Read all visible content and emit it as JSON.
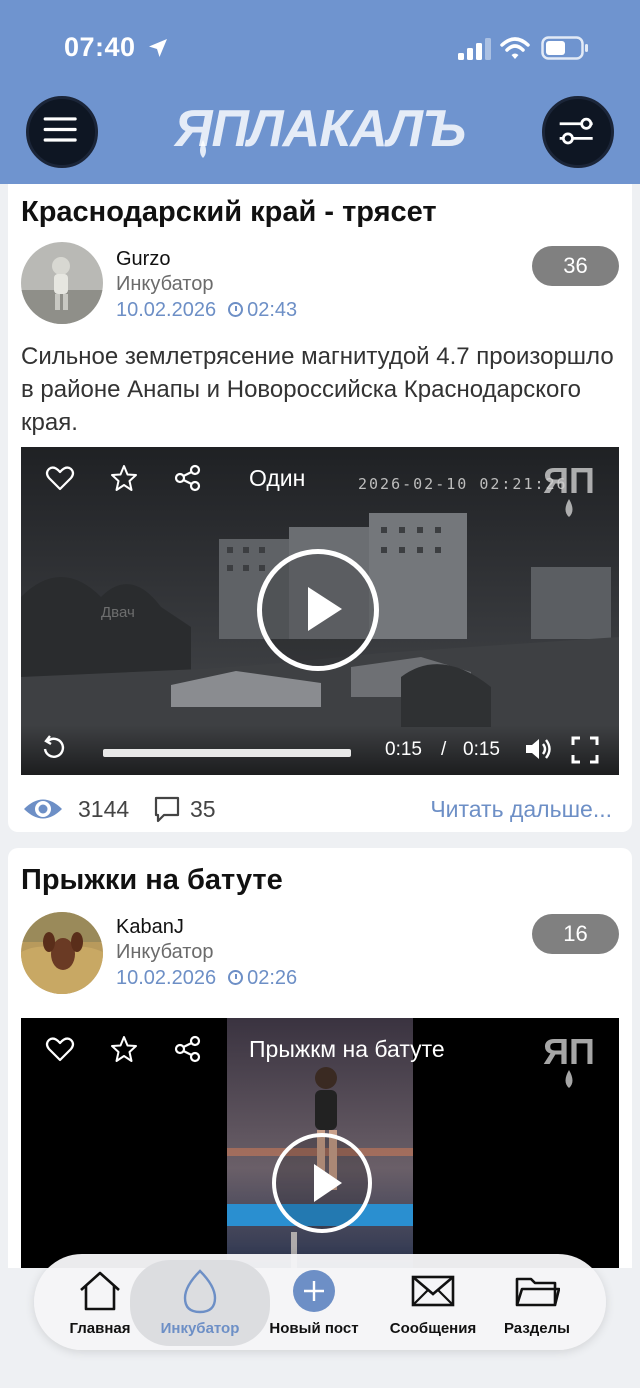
{
  "status_bar": {
    "time": "07:40"
  },
  "header": {
    "logo_text": "ЯПЛАКАЛЪ",
    "menu_icon": "hamburger-icon",
    "filter_icon": "settings-sliders-icon"
  },
  "posts": [
    {
      "title": "Краснодарский край - трясет",
      "author": "Gurzo",
      "section": "Инкубатор",
      "date": "10.02.2026",
      "time": "02:43",
      "rating": "36",
      "text": "Сильное землетрясение магнитудой 4.7 произоршло в районе Анапы и Новороссийска Краснодарского края.",
      "video": {
        "title": "Один",
        "overlay_timestamp": "2026-02-10 02:21:26",
        "watermark": "Двач",
        "current_time": "0:15",
        "separator": "/",
        "duration": "0:15",
        "progress": 1.0
      },
      "views": "3144",
      "comments": "35",
      "read_more": "Читать дальше..."
    },
    {
      "title": "Прыжки на батуте",
      "author": "KabanJ",
      "section": "Инкубатор",
      "date": "10.02.2026",
      "time": "02:26",
      "rating": "16",
      "video": {
        "title": "Прыжкм на батуте"
      }
    }
  ],
  "tabbar": {
    "items": [
      {
        "label": "Главная",
        "icon": "home-icon"
      },
      {
        "label": "Инкубатор",
        "icon": "egg-icon",
        "active": true
      },
      {
        "label": "Новый пост",
        "icon": "plus-circle-icon"
      },
      {
        "label": "Сообщения",
        "icon": "envelope-icon"
      },
      {
        "label": "Разделы",
        "icon": "folder-icon"
      }
    ]
  },
  "colors": {
    "header": "#6f94cf",
    "accent": "#6d8fc6",
    "rating_badge": "#808080",
    "button_dark": "#0e1623"
  }
}
